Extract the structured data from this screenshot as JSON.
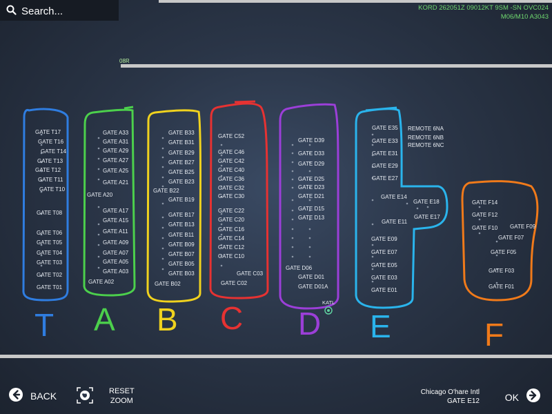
{
  "search": {
    "label": "Search..."
  },
  "weather": {
    "line1": "KORD 262051Z 09012KT 9SM -SN OVC024",
    "line2": "M06/M10 A3043"
  },
  "runway_label": "08R",
  "marker_label": "KATL",
  "concourse_letters": [
    "T",
    "A",
    "B",
    "C",
    "D",
    "E",
    "F"
  ],
  "concourse_colors": {
    "T": "#2f7de0",
    "A": "#4cd04c",
    "B": "#f0d21e",
    "C": "#e63232",
    "D": "#9b3fd8",
    "E": "#2ab4ec",
    "F": "#f07a1a"
  },
  "gates": {
    "T": [
      "GATE T17",
      "GATE T16",
      "GATE T14",
      "GATE T13",
      "GATE T12",
      "GATE T11",
      "GATE T10",
      "GATE T08",
      "GATE T06",
      "GATE T05",
      "GATE T04",
      "GATE T03",
      "GATE T02",
      "GATE T01"
    ],
    "A": [
      "GATE A33",
      "GATE A31",
      "GATE A29",
      "GATE A27",
      "GATE A25",
      "GATE A21",
      "GATE A20",
      "GATE A17",
      "GATE A15",
      "GATE A11",
      "GATE A09",
      "GATE A07",
      "GATE A05",
      "GATE A03",
      "GATE A02"
    ],
    "B": [
      "GATE B33",
      "GATE B31",
      "GATE B29",
      "GATE B27",
      "GATE B25",
      "GATE B23",
      "GATE B22",
      "GATE B19",
      "GATE B17",
      "GATE B13",
      "GATE B11",
      "GATE B09",
      "GATE B07",
      "GATE B05",
      "GATE B03",
      "GATE B02"
    ],
    "C": [
      "GATE C52",
      "GATE C46",
      "GATE C42",
      "GATE C40",
      "GATE C36",
      "GATE C32",
      "GATE C30",
      "GATE C22",
      "GATE C20",
      "GATE C16",
      "GATE C14",
      "GATE C12",
      "GATE C10",
      "GATE C03",
      "GATE C02"
    ],
    "D": [
      "GATE D39",
      "GATE D33",
      "GATE D29",
      "GATE D25",
      "GATE D23",
      "GATE D21",
      "GATE D15",
      "GATE D13",
      "GATE D06",
      "GATE D01",
      "GATE D01A"
    ],
    "E": [
      "GATE E35",
      "GATE E33",
      "GATE E31",
      "GATE E29",
      "GATE E27",
      "GATE E14",
      "GATE E18",
      "GATE E11",
      "GATE E17",
      "GATE E09",
      "GATE E07",
      "GATE E05",
      "GATE E03",
      "GATE E01"
    ],
    "REMOTE": [
      "REMOTE 6NA",
      "REMOTE 6NB",
      "REMOTE 6NC"
    ],
    "F": [
      "GATE F14",
      "GATE F12",
      "GATE F10",
      "GATE F09",
      "GATE F07",
      "GATE F05",
      "GATE F03",
      "GATE F01"
    ]
  },
  "bottom": {
    "back_label": "BACK",
    "reset_label_line1": "RESET",
    "reset_label_line2": "ZOOM",
    "airport_name": "Chicago O'hare Intl",
    "selected_gate": "GATE E12",
    "ok_label": "OK"
  }
}
